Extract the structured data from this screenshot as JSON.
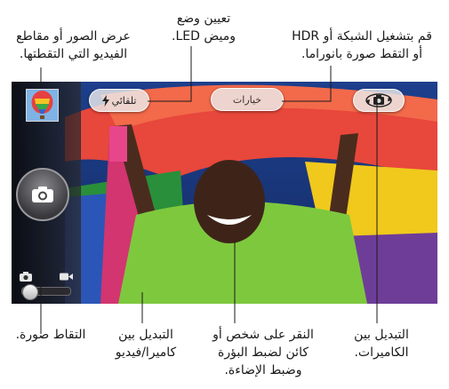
{
  "callouts": {
    "view_photos": {
      "line1": "عرض الصور أو مقاطع",
      "line2": "الفيديو التي التقطتها."
    },
    "flash": {
      "line1": "تعيين وضع",
      "line2": "وميض LED."
    },
    "hdr": {
      "line1": "قم بتشغيل الشبكة أو HDR",
      "line2": "أو التقط صورة بانوراما."
    },
    "take_photo": {
      "line1": "التقاط صورة."
    },
    "switch_mode": {
      "line1": "التبديل بين",
      "line2": "كاميرا/فيديو"
    },
    "focus": {
      "line1": "النقر على شخص أو",
      "line2": "كائن لضبط البؤرة",
      "line3": "وضبط الإضاءة."
    },
    "switch_cameras": {
      "line1": "التبديل بين",
      "line2": "الكاميرات."
    }
  },
  "camera": {
    "flash_label": "تلقائي",
    "options_label": "خيارات"
  },
  "icons": {
    "flash": "lightning-bolt",
    "shutter": "camera",
    "photo_mode": "camera",
    "video_mode": "video-camera",
    "switch_cameras": "camera-rotate-arrows"
  },
  "colors": {
    "options_text": "#3a3030",
    "leader_lines": "#1a1a1a"
  }
}
